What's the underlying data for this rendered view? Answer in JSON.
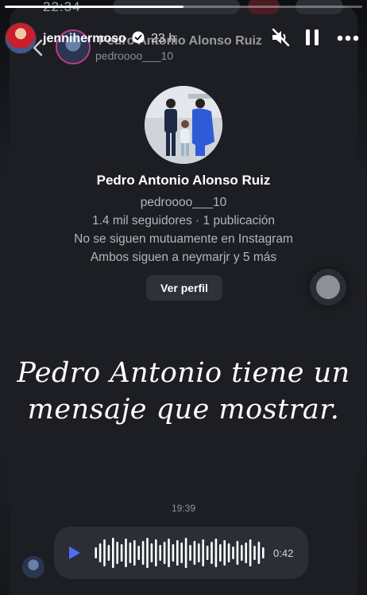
{
  "status_bar": {
    "time": "22:34"
  },
  "story": {
    "progress": 0.5,
    "username": "jennihermoso",
    "time_ago": "23 h"
  },
  "chat_header": {
    "name": "Pedro Antonio Alonso Ruiz",
    "handle": "pedroooo___10"
  },
  "profile": {
    "name": "Pedro Antonio Alonso Ruiz",
    "handle": "pedroooo___10",
    "stats": "1.4 mil seguidores · 1 publicación",
    "mutual": "No se siguen mutuamente en Instagram",
    "followers_in_common": "Ambos siguen a neymarjr y 5 más",
    "view_profile_label": "Ver perfil"
  },
  "overlay": {
    "line1": "Pedro Antonio tiene un",
    "line2": "mensaje que mostrar."
  },
  "message": {
    "timestamp": "19:39",
    "voice_duration": "0:42",
    "waveform_levels": [
      0.35,
      0.6,
      0.85,
      0.5,
      0.95,
      0.7,
      0.55,
      0.9,
      0.65,
      0.8,
      0.45,
      0.75,
      0.95,
      0.6,
      0.85,
      0.5,
      0.7,
      0.9,
      0.55,
      0.8,
      0.65,
      0.95,
      0.5,
      0.75,
      0.6,
      0.85,
      0.45,
      0.7,
      0.9,
      0.55,
      0.8,
      0.6,
      0.4,
      0.75,
      0.5,
      0.65,
      0.85,
      0.45,
      0.7,
      0.35
    ]
  },
  "colors": {
    "background": "#1c1e23",
    "accent_play": "#4f6ef7",
    "bubble": "#2b2e35"
  },
  "icons": [
    "verified-icon",
    "mute-icon",
    "pause-icon",
    "more-icon",
    "back-icon",
    "play-icon"
  ]
}
